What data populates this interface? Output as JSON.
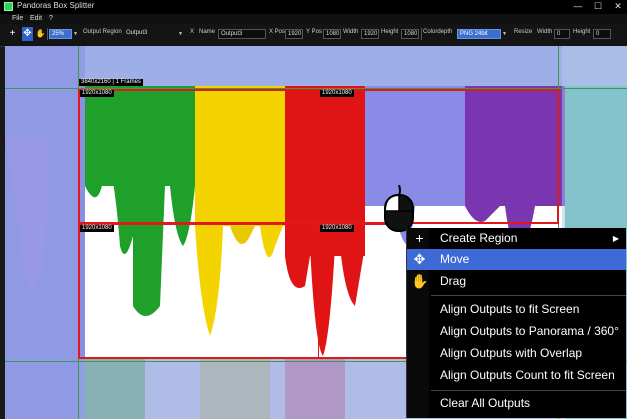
{
  "window": {
    "title": "Pandoras Box Splitter",
    "minimize": "—",
    "maximize": "☐",
    "close": "✕"
  },
  "menu": {
    "items": [
      "File",
      "Edit",
      "?"
    ]
  },
  "toolbar": {
    "add": "+",
    "move": "✥",
    "hand": "✋",
    "zoom": "25%",
    "output_region_label": "Output Region",
    "output_region_value": "Output3",
    "x_button": "X",
    "name_label": "Name",
    "name_value": "Output3",
    "xpos_label": "X Pos",
    "xpos_value": "1920",
    "ypos_label": "Y Pos",
    "ypos_value": "1080",
    "width_label": "Width",
    "width_value": "1920",
    "height_label": "Height",
    "height_value": "1080",
    "colordepth_label": "Colordepth",
    "colordepth_value": "PNG 24bit",
    "resize_label": "Resize",
    "resize_width_label": "Width",
    "resize_width_value": "0",
    "resize_height_label": "Height",
    "resize_height_value": "0"
  },
  "canvas": {
    "info_label": "3840x2160 | 1 Frames",
    "regions": [
      {
        "label": "1920x1080"
      },
      {
        "label": "1920x1080"
      },
      {
        "label": "1920x1080"
      },
      {
        "label": "1920x1080"
      }
    ]
  },
  "context_menu": {
    "items": [
      {
        "label": "Create Region",
        "icon": "plus-icon",
        "glyph": "+",
        "submenu": "▶"
      },
      {
        "label": "Move",
        "icon": "move-icon",
        "glyph": "✥"
      },
      {
        "label": "Drag",
        "icon": "hand-icon",
        "glyph": "✋"
      },
      {
        "label": "Align Outputs to fit Screen"
      },
      {
        "label": "Align Outputs to Panorama / 360°"
      },
      {
        "label": "Align Outputs with Overlap"
      },
      {
        "label": "Align Outputs Count to fit Screen"
      },
      {
        "label": "Clear All Outputs"
      }
    ]
  },
  "colors": {
    "accent": "#3d6ad6",
    "region": "#e01818",
    "grid": "#3c9a4c"
  }
}
